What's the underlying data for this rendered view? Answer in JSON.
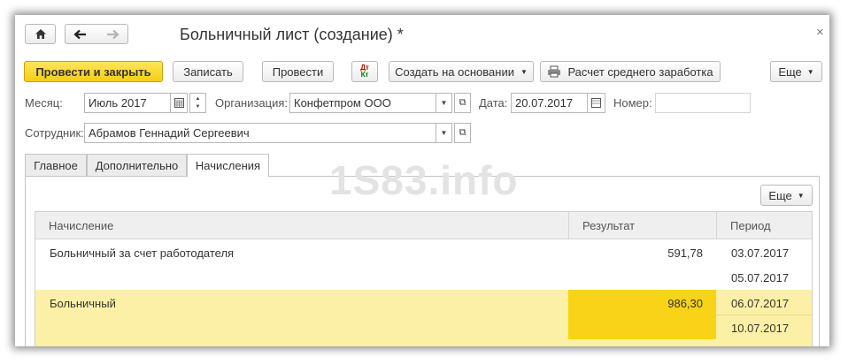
{
  "window": {
    "title": "Больничный лист (создание) *"
  },
  "toolbar": {
    "post_close": "Провести и закрыть",
    "save": "Записать",
    "post": "Провести",
    "dtkt_top": "Дт",
    "dtkt_bottom": "Кт",
    "create_based": "Создать на основании",
    "calc_avg": "Расчет среднего заработка",
    "more": "Еще"
  },
  "form": {
    "month_label": "Месяц:",
    "month_value": "Июль 2017",
    "org_label": "Организация:",
    "org_value": "Конфетпром ООО",
    "date_label": "Дата:",
    "date_value": "20.07.2017",
    "number_label": "Номер:",
    "number_value": "",
    "employee_label": "Сотрудник:",
    "employee_value": "Абрамов Геннадий Сергеевич"
  },
  "tabs": [
    {
      "label": "Главное"
    },
    {
      "label": "Дополнительно"
    },
    {
      "label": "Начисления"
    }
  ],
  "watermark": "1S83.info",
  "accruals": {
    "more": "Еще",
    "headers": {
      "accrual": "Начисление",
      "result": "Результат",
      "period": "Период"
    },
    "rows": [
      {
        "accrual": "Больничный за счет работодателя",
        "result": "591,78",
        "period_from": "03.07.2017",
        "period_to": "05.07.2017"
      },
      {
        "accrual": "Больничный",
        "result": "986,30",
        "period_from": "06.07.2017",
        "period_to": "10.07.2017"
      }
    ]
  },
  "colors": {
    "primary_button": "#f5cf14",
    "selected_row": "#fbf0a6",
    "selected_cell": "#f8d317"
  }
}
